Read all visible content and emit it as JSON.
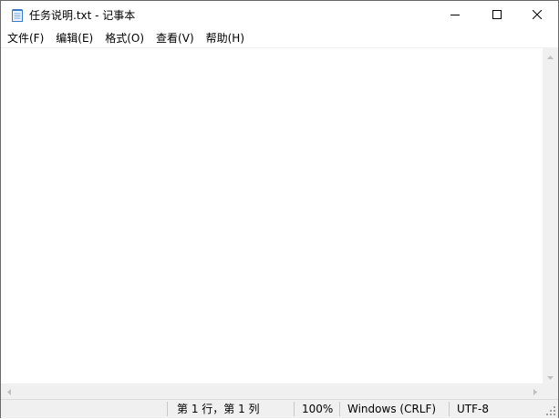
{
  "window": {
    "title": "任务说明.txt - 记事本",
    "accent_border": "#6a6a6a"
  },
  "icons": {
    "app": "notepad-icon",
    "minimize": "minimize-icon",
    "maximize": "maximize-icon",
    "close": "close-icon"
  },
  "menu": {
    "items": [
      "文件(F)",
      "编辑(E)",
      "格式(O)",
      "查看(V)",
      "帮助(H)"
    ]
  },
  "editor": {
    "content": ""
  },
  "statusbar": {
    "position": "第 1 行，第 1 列",
    "zoom": "100%",
    "line_ending": "Windows (CRLF)",
    "encoding": "UTF-8"
  }
}
